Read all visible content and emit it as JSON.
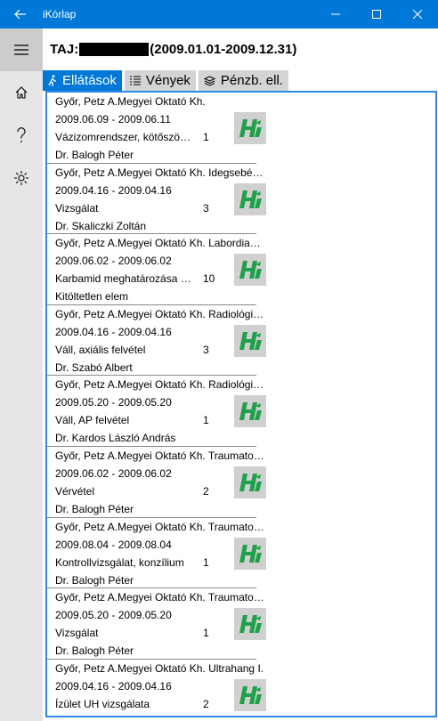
{
  "window": {
    "title": "iKórlap"
  },
  "header": {
    "taj_label": "TAJ:",
    "period": "(2009.01.01-2009.12.31)"
  },
  "tabs": [
    {
      "label": "Ellátások",
      "icon": "person-walking-icon"
    },
    {
      "label": "Vények",
      "icon": "list-icon"
    },
    {
      "label": "Pénzb. ell.",
      "icon": "layers-icon"
    }
  ],
  "items": [
    {
      "hospital": "Győr, Petz A.Megyei Oktató Kh.",
      "dates": "2009.06.09 - 2009.06.11",
      "description": "Vázizomrendszer, kötőszöve...",
      "quantity": "1",
      "doctor": "Dr. Balogh Péter"
    },
    {
      "hospital": "Győr, Petz A.Megyei Oktató Kh. Idegsebészet",
      "dates": "2009.04.16 - 2009.04.16",
      "description": "Vizsgálat",
      "quantity": "3",
      "doctor": "Dr. Skaliczki Zoltán"
    },
    {
      "hospital": "Győr, Petz A.Megyei Oktató Kh. Labordiagn...",
      "dates": "2009.06.02 - 2009.06.02",
      "description": "Karbamid meghatározása sz...",
      "quantity": "10",
      "doctor": "Kitöltetlen elem"
    },
    {
      "hospital": "Győr, Petz A.Megyei Oktató Kh. Radiológia I.",
      "dates": "2009.04.16 - 2009.04.16",
      "description": "Váll, axiális felvétel",
      "quantity": "3",
      "doctor": "Dr. Szabó Albert"
    },
    {
      "hospital": "Győr, Petz A.Megyei Oktató Kh. Radiológia I.",
      "dates": "2009.05.20 - 2009.05.20",
      "description": "Váll, AP felvétel",
      "quantity": "1",
      "doctor": "Dr. Kardos László András"
    },
    {
      "hospital": "Győr, Petz A.Megyei Oktató Kh. Traumatoló...",
      "dates": "2009.06.02 - 2009.06.02",
      "description": "Vérvétel",
      "quantity": "2",
      "doctor": "Dr. Balogh Péter"
    },
    {
      "hospital": "Győr, Petz A.Megyei Oktató Kh. Traumatoló...",
      "dates": "2009.08.04 - 2009.08.04",
      "description": "Kontrollvizsgálat, konzílium",
      "quantity": "1",
      "doctor": "Dr. Balogh Péter"
    },
    {
      "hospital": "Győr, Petz A.Megyei Oktató Kh. Traumatoló...",
      "dates": "2009.05.20 - 2009.05.20",
      "description": "Vizsgálat",
      "quantity": "1",
      "doctor": "Dr. Balogh Péter"
    },
    {
      "hospital": "Győr, Petz A.Megyei Oktató Kh. Ultrahang I.",
      "dates": "2009.04.16 - 2009.04.16",
      "description": "Ízület UH vizsgálata",
      "quantity": "2",
      "doctor": ""
    }
  ],
  "colors": {
    "accent": "#0078d7",
    "list_border": "#2a8ce6",
    "logo_bg": "#d0d0d0",
    "logo_green": "#1fa04a"
  }
}
